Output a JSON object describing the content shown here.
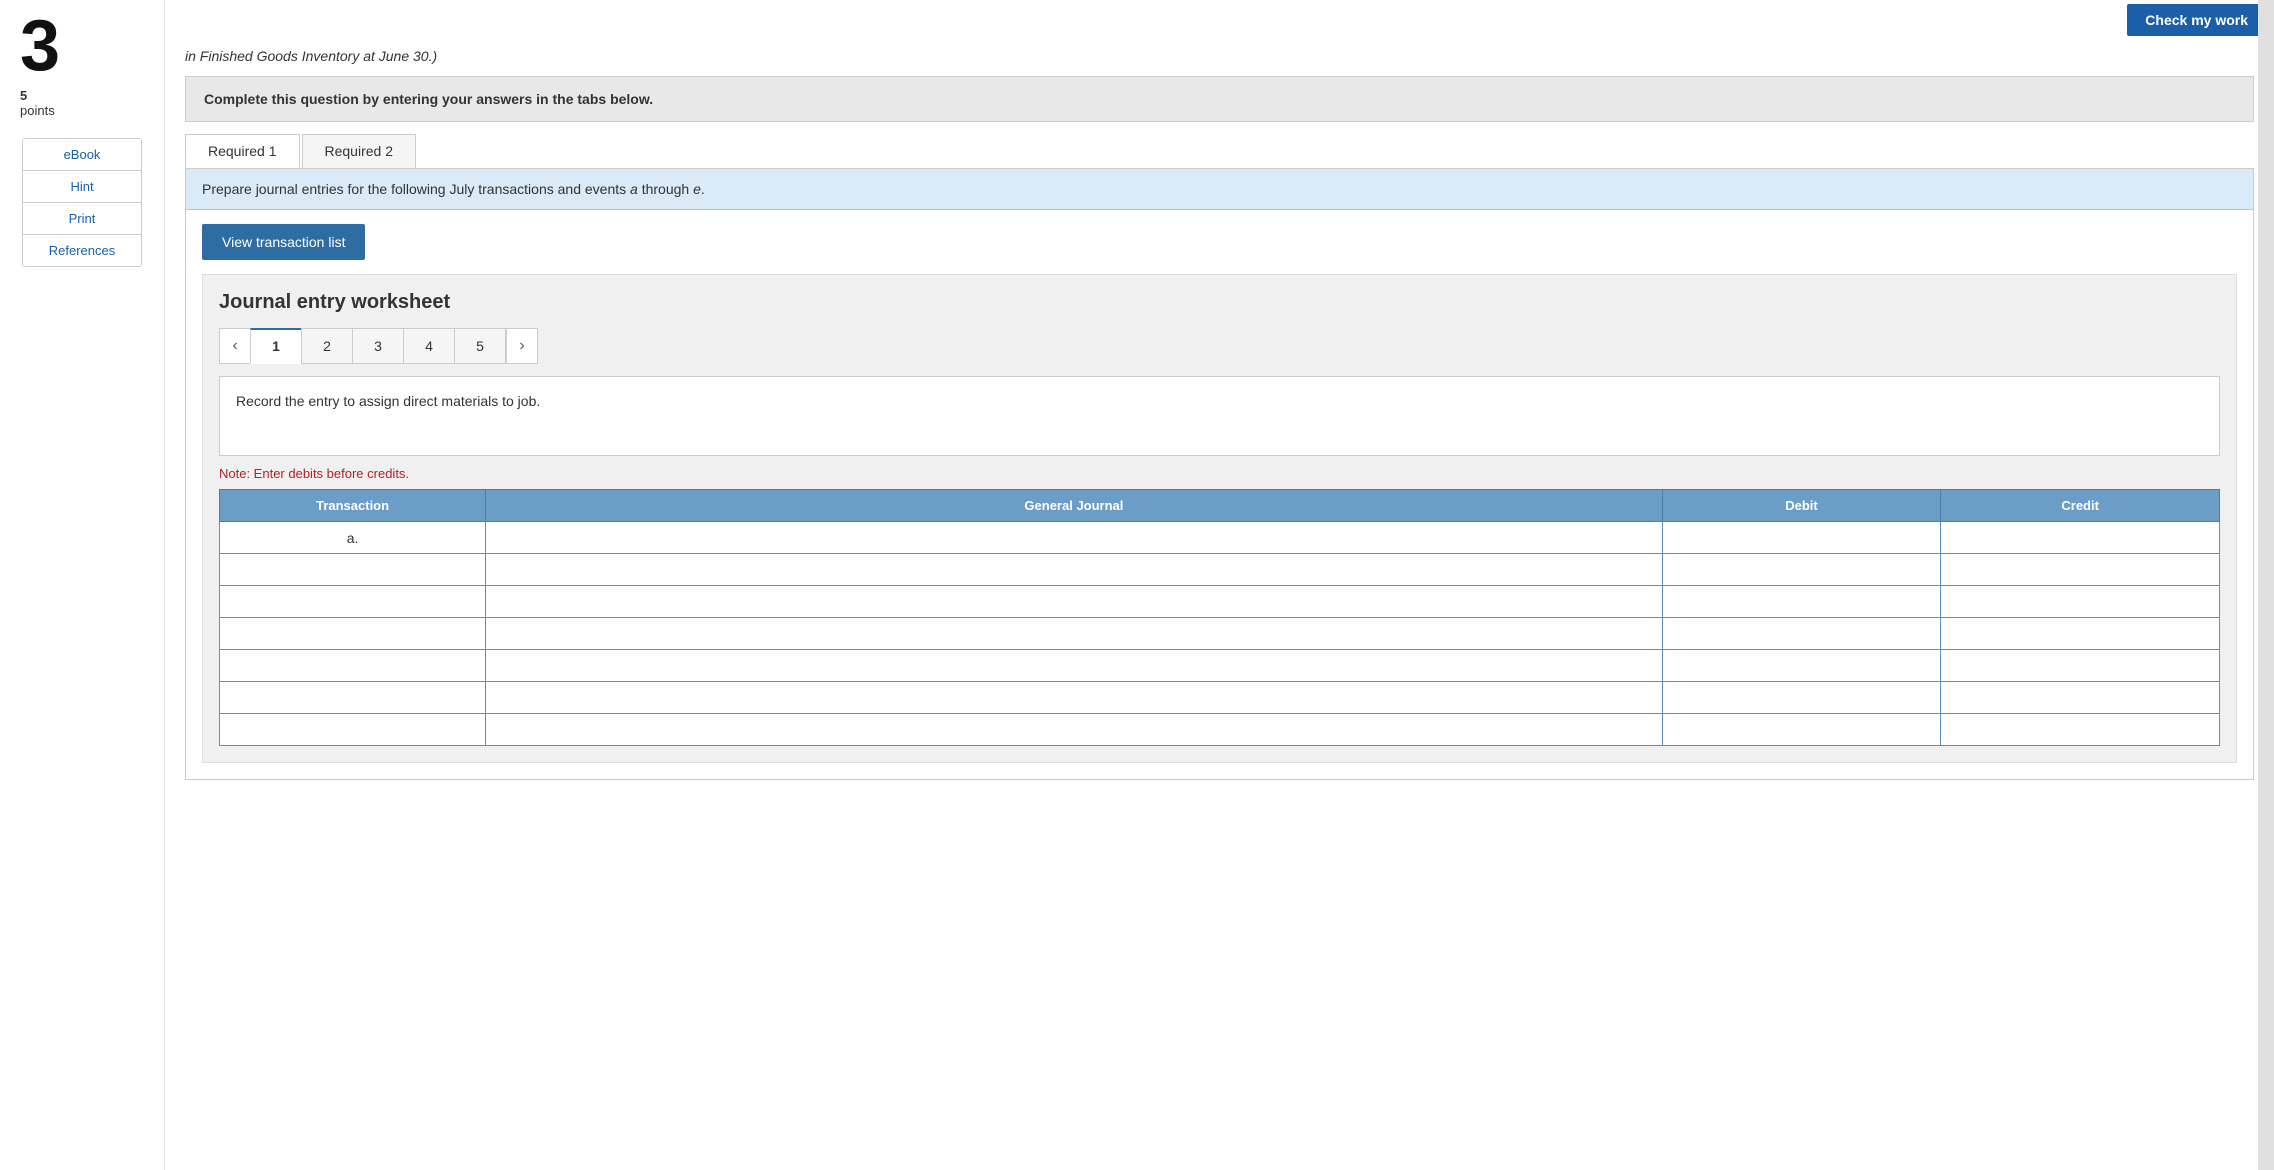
{
  "header": {
    "check_my_work_label": "Check my work"
  },
  "sidebar": {
    "question_number": "3",
    "points_value": "5",
    "points_label": "points",
    "links": [
      {
        "id": "ebook",
        "label": "eBook"
      },
      {
        "id": "hint",
        "label": "Hint"
      },
      {
        "id": "print",
        "label": "Print"
      },
      {
        "id": "references",
        "label": "References"
      }
    ]
  },
  "truncated_text": "in Finished Goods Inventory at June 30.)",
  "instruction_banner": "Complete this question by entering your answers in the tabs below.",
  "tabs": [
    {
      "id": "required1",
      "label": "Required 1",
      "active": true
    },
    {
      "id": "required2",
      "label": "Required 2",
      "active": false
    }
  ],
  "blue_instruction": "Prepare journal entries for the following July transactions and events a through e.",
  "view_transaction_btn_label": "View transaction list",
  "journal_worksheet": {
    "title": "Journal entry worksheet",
    "entries": [
      {
        "id": "1",
        "label": "1",
        "active": true
      },
      {
        "id": "2",
        "label": "2",
        "active": false
      },
      {
        "id": "3",
        "label": "3",
        "active": false
      },
      {
        "id": "4",
        "label": "4",
        "active": false
      },
      {
        "id": "5",
        "label": "5",
        "active": false
      }
    ],
    "entry_description": "Record the entry to assign direct materials to job.",
    "note_text": "Note: Enter debits before credits.",
    "table": {
      "headers": [
        "Transaction",
        "General Journal",
        "Debit",
        "Credit"
      ],
      "rows": [
        {
          "transaction": "a.",
          "journal": "",
          "debit": "",
          "credit": ""
        },
        {
          "transaction": "",
          "journal": "",
          "debit": "",
          "credit": ""
        },
        {
          "transaction": "",
          "journal": "",
          "debit": "",
          "credit": ""
        },
        {
          "transaction": "",
          "journal": "",
          "debit": "",
          "credit": ""
        },
        {
          "transaction": "",
          "journal": "",
          "debit": "",
          "credit": ""
        },
        {
          "transaction": "",
          "journal": "",
          "debit": "",
          "credit": ""
        },
        {
          "transaction": "",
          "journal": "",
          "debit": "",
          "credit": ""
        }
      ]
    }
  }
}
